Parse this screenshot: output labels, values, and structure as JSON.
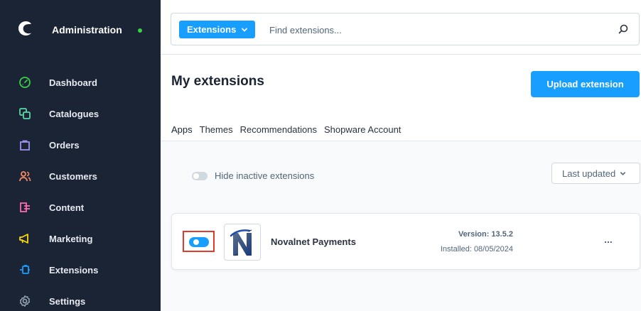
{
  "sidebar": {
    "title": "Administration",
    "status_color": "#37d046",
    "items": [
      {
        "label": "Dashboard",
        "icon": "dashboard-icon",
        "color": "#37d046"
      },
      {
        "label": "Catalogues",
        "icon": "catalogues-icon",
        "color": "#57d9a3"
      },
      {
        "label": "Orders",
        "icon": "orders-icon",
        "color": "#a092f0"
      },
      {
        "label": "Customers",
        "icon": "customers-icon",
        "color": "#f88962"
      },
      {
        "label": "Content",
        "icon": "content-icon",
        "color": "#ff68b4"
      },
      {
        "label": "Marketing",
        "icon": "marketing-icon",
        "color": "#ffd700"
      },
      {
        "label": "Extensions",
        "icon": "extensions-icon",
        "color": "#189eff"
      },
      {
        "label": "Settings",
        "icon": "settings-icon",
        "color": "#9aa8b5"
      }
    ]
  },
  "search": {
    "type_label": "Extensions",
    "placeholder": "Find extensions..."
  },
  "page": {
    "title": "My extensions",
    "upload_label": "Upload extension"
  },
  "tabs": [
    "Apps",
    "Themes",
    "Recommendations",
    "Shopware Account"
  ],
  "filters": {
    "hide_inactive_label": "Hide inactive extensions",
    "sort_label": "Last updated"
  },
  "extension": {
    "name": "Novalnet Payments",
    "version": "Version: 13.5.2",
    "installed": "Installed: 08/05/2024",
    "active": true,
    "menu": "..."
  },
  "colors": {
    "accent": "#189eff",
    "sidebar_bg": "#1b2434",
    "highlight": "#e23b2b"
  }
}
